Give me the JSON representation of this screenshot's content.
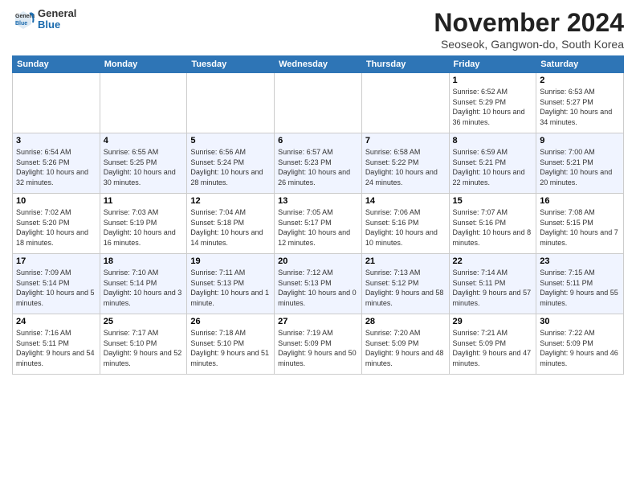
{
  "header": {
    "logo": {
      "general": "General",
      "blue": "Blue"
    },
    "title": "November 2024",
    "location": "Seoseok, Gangwon-do, South Korea"
  },
  "weekdays": [
    "Sunday",
    "Monday",
    "Tuesday",
    "Wednesday",
    "Thursday",
    "Friday",
    "Saturday"
  ],
  "weeks": [
    [
      {
        "day": "",
        "info": ""
      },
      {
        "day": "",
        "info": ""
      },
      {
        "day": "",
        "info": ""
      },
      {
        "day": "",
        "info": ""
      },
      {
        "day": "",
        "info": ""
      },
      {
        "day": "1",
        "info": "Sunrise: 6:52 AM\nSunset: 5:29 PM\nDaylight: 10 hours and 36 minutes."
      },
      {
        "day": "2",
        "info": "Sunrise: 6:53 AM\nSunset: 5:27 PM\nDaylight: 10 hours and 34 minutes."
      }
    ],
    [
      {
        "day": "3",
        "info": "Sunrise: 6:54 AM\nSunset: 5:26 PM\nDaylight: 10 hours and 32 minutes."
      },
      {
        "day": "4",
        "info": "Sunrise: 6:55 AM\nSunset: 5:25 PM\nDaylight: 10 hours and 30 minutes."
      },
      {
        "day": "5",
        "info": "Sunrise: 6:56 AM\nSunset: 5:24 PM\nDaylight: 10 hours and 28 minutes."
      },
      {
        "day": "6",
        "info": "Sunrise: 6:57 AM\nSunset: 5:23 PM\nDaylight: 10 hours and 26 minutes."
      },
      {
        "day": "7",
        "info": "Sunrise: 6:58 AM\nSunset: 5:22 PM\nDaylight: 10 hours and 24 minutes."
      },
      {
        "day": "8",
        "info": "Sunrise: 6:59 AM\nSunset: 5:21 PM\nDaylight: 10 hours and 22 minutes."
      },
      {
        "day": "9",
        "info": "Sunrise: 7:00 AM\nSunset: 5:21 PM\nDaylight: 10 hours and 20 minutes."
      }
    ],
    [
      {
        "day": "10",
        "info": "Sunrise: 7:02 AM\nSunset: 5:20 PM\nDaylight: 10 hours and 18 minutes."
      },
      {
        "day": "11",
        "info": "Sunrise: 7:03 AM\nSunset: 5:19 PM\nDaylight: 10 hours and 16 minutes."
      },
      {
        "day": "12",
        "info": "Sunrise: 7:04 AM\nSunset: 5:18 PM\nDaylight: 10 hours and 14 minutes."
      },
      {
        "day": "13",
        "info": "Sunrise: 7:05 AM\nSunset: 5:17 PM\nDaylight: 10 hours and 12 minutes."
      },
      {
        "day": "14",
        "info": "Sunrise: 7:06 AM\nSunset: 5:16 PM\nDaylight: 10 hours and 10 minutes."
      },
      {
        "day": "15",
        "info": "Sunrise: 7:07 AM\nSunset: 5:16 PM\nDaylight: 10 hours and 8 minutes."
      },
      {
        "day": "16",
        "info": "Sunrise: 7:08 AM\nSunset: 5:15 PM\nDaylight: 10 hours and 7 minutes."
      }
    ],
    [
      {
        "day": "17",
        "info": "Sunrise: 7:09 AM\nSunset: 5:14 PM\nDaylight: 10 hours and 5 minutes."
      },
      {
        "day": "18",
        "info": "Sunrise: 7:10 AM\nSunset: 5:14 PM\nDaylight: 10 hours and 3 minutes."
      },
      {
        "day": "19",
        "info": "Sunrise: 7:11 AM\nSunset: 5:13 PM\nDaylight: 10 hours and 1 minute."
      },
      {
        "day": "20",
        "info": "Sunrise: 7:12 AM\nSunset: 5:13 PM\nDaylight: 10 hours and 0 minutes."
      },
      {
        "day": "21",
        "info": "Sunrise: 7:13 AM\nSunset: 5:12 PM\nDaylight: 9 hours and 58 minutes."
      },
      {
        "day": "22",
        "info": "Sunrise: 7:14 AM\nSunset: 5:11 PM\nDaylight: 9 hours and 57 minutes."
      },
      {
        "day": "23",
        "info": "Sunrise: 7:15 AM\nSunset: 5:11 PM\nDaylight: 9 hours and 55 minutes."
      }
    ],
    [
      {
        "day": "24",
        "info": "Sunrise: 7:16 AM\nSunset: 5:11 PM\nDaylight: 9 hours and 54 minutes."
      },
      {
        "day": "25",
        "info": "Sunrise: 7:17 AM\nSunset: 5:10 PM\nDaylight: 9 hours and 52 minutes."
      },
      {
        "day": "26",
        "info": "Sunrise: 7:18 AM\nSunset: 5:10 PM\nDaylight: 9 hours and 51 minutes."
      },
      {
        "day": "27",
        "info": "Sunrise: 7:19 AM\nSunset: 5:09 PM\nDaylight: 9 hours and 50 minutes."
      },
      {
        "day": "28",
        "info": "Sunrise: 7:20 AM\nSunset: 5:09 PM\nDaylight: 9 hours and 48 minutes."
      },
      {
        "day": "29",
        "info": "Sunrise: 7:21 AM\nSunset: 5:09 PM\nDaylight: 9 hours and 47 minutes."
      },
      {
        "day": "30",
        "info": "Sunrise: 7:22 AM\nSunset: 5:09 PM\nDaylight: 9 hours and 46 minutes."
      }
    ]
  ]
}
